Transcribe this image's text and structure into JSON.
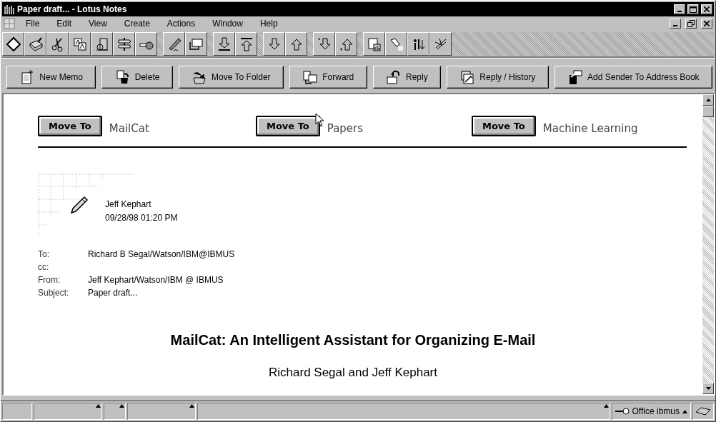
{
  "window": {
    "title": "Paper draft... - Lotus Notes"
  },
  "menu": [
    {
      "label": "File"
    },
    {
      "label": "Edit"
    },
    {
      "label": "View"
    },
    {
      "label": "Create"
    },
    {
      "label": "Actions"
    },
    {
      "label": "Window"
    },
    {
      "label": "Help"
    }
  ],
  "action_bar": [
    {
      "label": "New Memo"
    },
    {
      "label": "Delete"
    },
    {
      "label": "Move To Folder"
    },
    {
      "label": "Forward"
    },
    {
      "label": "Reply"
    },
    {
      "label": "Reply / History"
    },
    {
      "label": "Add Sender To Address Book"
    }
  ],
  "folders": [
    {
      "button": "Move To",
      "folder": "MailCat"
    },
    {
      "button": "Move To",
      "folder": "Papers"
    },
    {
      "button": "Move To",
      "folder": "Machine Learning"
    }
  ],
  "memo": {
    "author": "Jeff Kephart",
    "date": "09/28/98 01:20 PM",
    "fields": [
      {
        "label": "To:",
        "value": "Richard B Segal/Watson/IBM@IBMUS"
      },
      {
        "label": "cc:"
      },
      {
        "label": "From:",
        "value": "Jeff Kephart/Watson/IBM @ IBMUS"
      },
      {
        "label": "Subject:",
        "value": "Paper draft..."
      }
    ]
  },
  "body": {
    "title": "MailCat: An Intelligent Assistant for Organizing E-Mail",
    "authors": "Richard Segal and Jeff Kephart"
  },
  "status_bar": {
    "location": "Office ibmus"
  }
}
